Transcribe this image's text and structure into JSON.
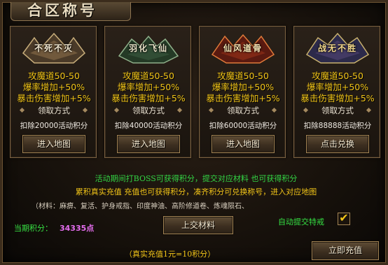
{
  "title": "合区称号",
  "cards": [
    {
      "emblem_text": "不死不灭",
      "emblem_color": "#f0e6cf",
      "stats": [
        "攻魔道50-50",
        "爆率增加+50%",
        "暴击伤害增加+5%"
      ],
      "method_label": "领取方式",
      "deduct_label": "扣除20000活动积分",
      "button_label": "进入地图"
    },
    {
      "emblem_text": "羽化飞仙",
      "emblem_color": "#e9e3c8",
      "stats": [
        "攻魔道50-50",
        "爆率增加+50%",
        "暴击伤害增加+5%"
      ],
      "method_label": "领取方式",
      "deduct_label": "扣除40000活动积分",
      "button_label": "进入地图"
    },
    {
      "emblem_text": "仙风道骨",
      "emblem_color": "#f5e3b2",
      "stats": [
        "攻魔道50-50",
        "爆率增加+50%",
        "暴击伤害增加+5%"
      ],
      "method_label": "领取方式",
      "deduct_label": "扣除60000活动积分",
      "button_label": "进入地图"
    },
    {
      "emblem_text": "战无不胜",
      "emblem_color": "#f4d98c",
      "stats": [
        "攻魔道50-50",
        "爆率增加+50%",
        "暴击伤害增加+5%"
      ],
      "method_label": "领取方式",
      "deduct_label": "扣除88888活动积分",
      "button_label": "点击兑换"
    }
  ],
  "info": {
    "line1": "活动期间打BOSS可获得积分，提交对应材料 也可获得积分",
    "line2": "累积真实充值 充值也可获得积分，凑齐积分可兑换称号，进入对应地图",
    "line3": "（材料：麻痹、复活、护身戒指、印度神油、高阶修道卷、炼魂陨石、"
  },
  "points": {
    "label": "当期积分：",
    "value": "34335点"
  },
  "submit_button": "上交材料",
  "auto_submit": {
    "label": "自动提交特戒",
    "checked": true,
    "mark": "✔"
  },
  "note": "（真实充值1元=10积分）",
  "recharge_button": "立即充值",
  "colors": {
    "stat_text": "#f1c418",
    "green_text": "#33d444",
    "points_value": "#e66ef0",
    "card_border": "#7b6141"
  }
}
